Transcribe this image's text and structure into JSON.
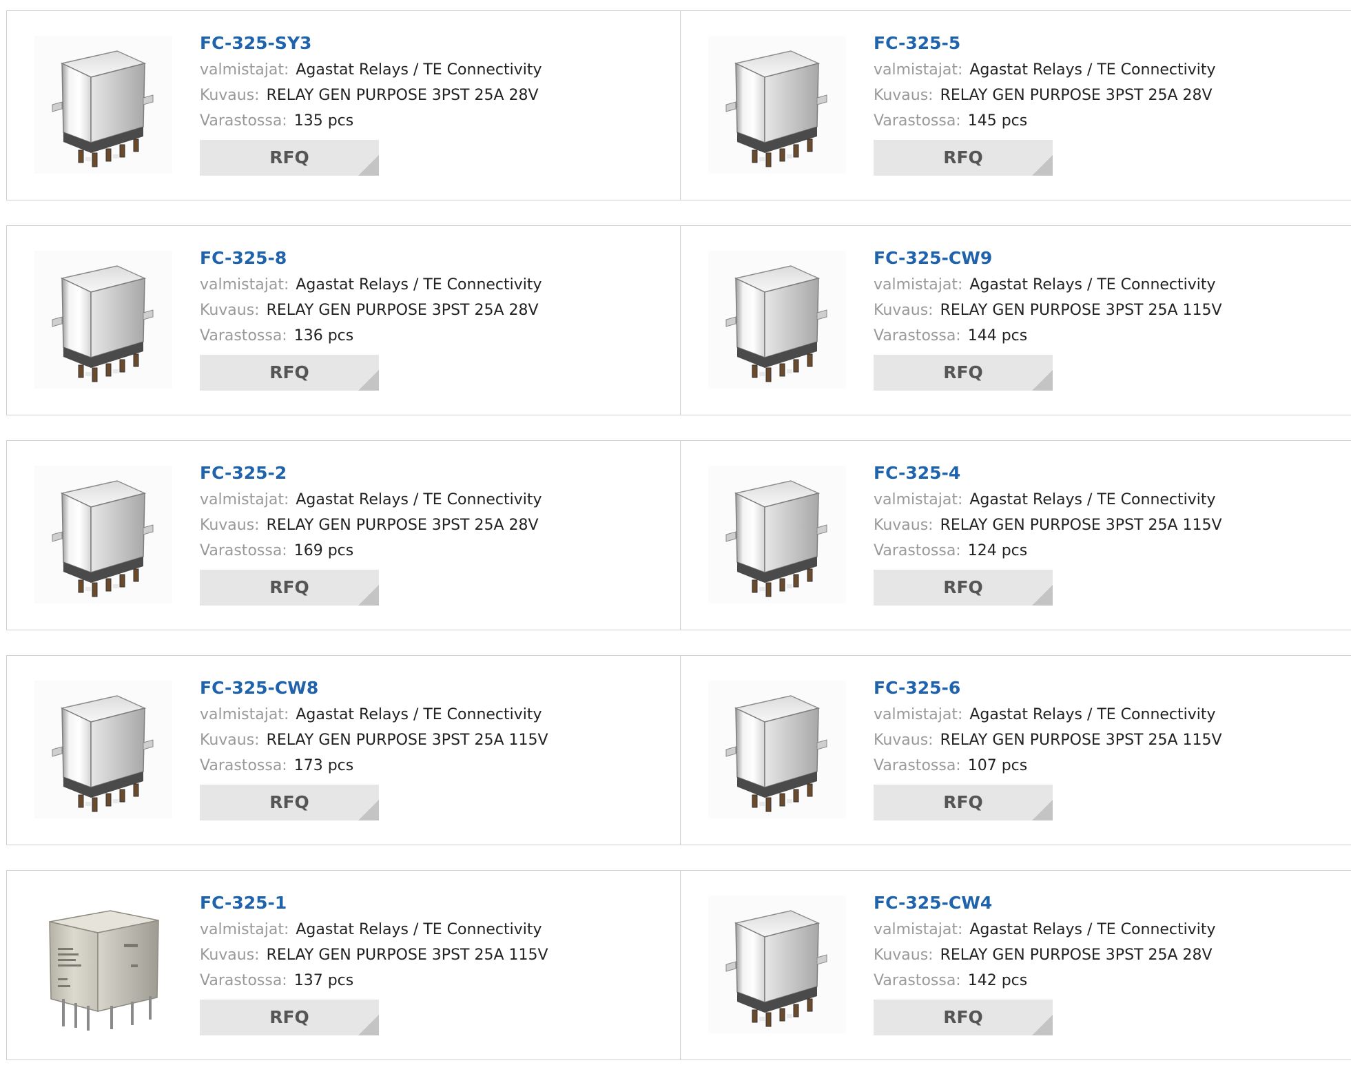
{
  "labels": {
    "manufacturer": "valmistajat:",
    "description": "Kuvaus:",
    "stock": "Varastossa:",
    "rfq": "RFQ"
  },
  "colors": {
    "part_link": "#1f63ad",
    "label": "#999999",
    "button_bg": "#e6e6e6",
    "border": "#cfcfcf"
  },
  "products": [
    {
      "pn": "FC-325-SY3",
      "mfr": "Agastat Relays / TE Connectivity",
      "desc": "RELAY GEN PURPOSE 3PST 25A 28V",
      "stock": "135 pcs",
      "image": "relay-icon"
    },
    {
      "pn": "FC-325-5",
      "mfr": "Agastat Relays / TE Connectivity",
      "desc": "RELAY GEN PURPOSE 3PST 25A 28V",
      "stock": "145 pcs",
      "image": "relay-icon"
    },
    {
      "pn": "FC-325-8",
      "mfr": "Agastat Relays / TE Connectivity",
      "desc": "RELAY GEN PURPOSE 3PST 25A 28V",
      "stock": "136 pcs",
      "image": "relay-icon"
    },
    {
      "pn": "FC-325-CW9",
      "mfr": "Agastat Relays / TE Connectivity",
      "desc": "RELAY GEN PURPOSE 3PST 25A 115V",
      "stock": "144 pcs",
      "image": "relay-icon"
    },
    {
      "pn": "FC-325-2",
      "mfr": "Agastat Relays / TE Connectivity",
      "desc": "RELAY GEN PURPOSE 3PST 25A 28V",
      "stock": "169 pcs",
      "image": "relay-icon"
    },
    {
      "pn": "FC-325-4",
      "mfr": "Agastat Relays / TE Connectivity",
      "desc": "RELAY GEN PURPOSE 3PST 25A 115V",
      "stock": "124 pcs",
      "image": "relay-icon"
    },
    {
      "pn": "FC-325-CW8",
      "mfr": "Agastat Relays / TE Connectivity",
      "desc": "RELAY GEN PURPOSE 3PST 25A 115V",
      "stock": "173 pcs",
      "image": "relay-icon"
    },
    {
      "pn": "FC-325-6",
      "mfr": "Agastat Relays / TE Connectivity",
      "desc": "RELAY GEN PURPOSE 3PST 25A 115V",
      "stock": "107 pcs",
      "image": "relay-icon"
    },
    {
      "pn": "FC-325-1",
      "mfr": "Agastat Relays / TE Connectivity",
      "desc": "RELAY GEN PURPOSE 3PST 25A 115V",
      "stock": "137 pcs",
      "image": "sealed-relay-icon"
    },
    {
      "pn": "FC-325-CW4",
      "mfr": "Agastat Relays / TE Connectivity",
      "desc": "RELAY GEN PURPOSE 3PST 25A 28V",
      "stock": "142 pcs",
      "image": "relay-icon"
    }
  ]
}
